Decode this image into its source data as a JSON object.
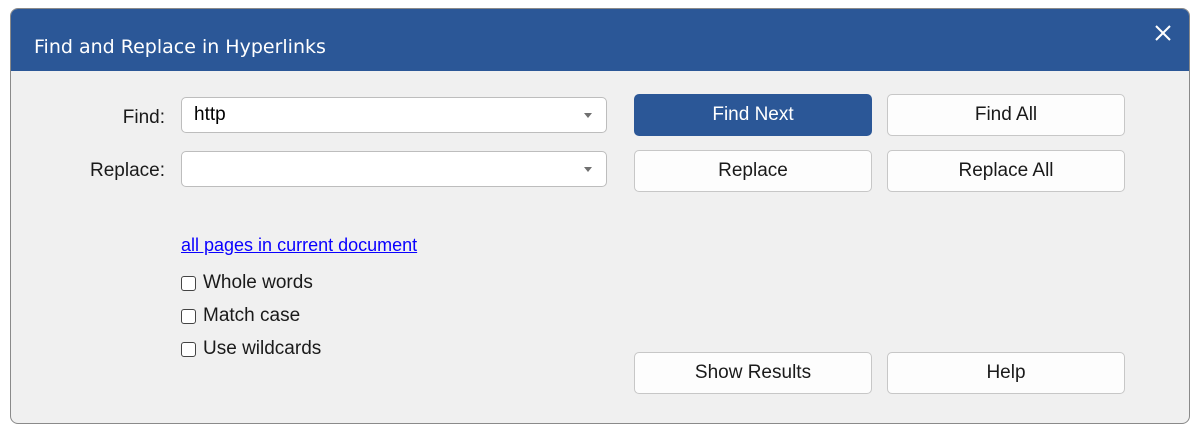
{
  "window": {
    "title": "Find and Replace in Hyperlinks",
    "accent_color": "#2b5797",
    "close_icon": "close-icon"
  },
  "find": {
    "label": "Find:",
    "value": "http",
    "placeholder": ""
  },
  "replace": {
    "label": "Replace:",
    "value": "",
    "placeholder": ""
  },
  "buttons": {
    "find_next": "Find Next",
    "find_all": "Find All",
    "replace": "Replace",
    "replace_all": "Replace All",
    "show_results": "Show Results",
    "help": "Help"
  },
  "scope": {
    "link_text": "all pages in current document"
  },
  "options": [
    {
      "label": "Whole words",
      "checked": false
    },
    {
      "label": "Match case",
      "checked": false
    },
    {
      "label": "Use wildcards",
      "checked": false
    }
  ]
}
